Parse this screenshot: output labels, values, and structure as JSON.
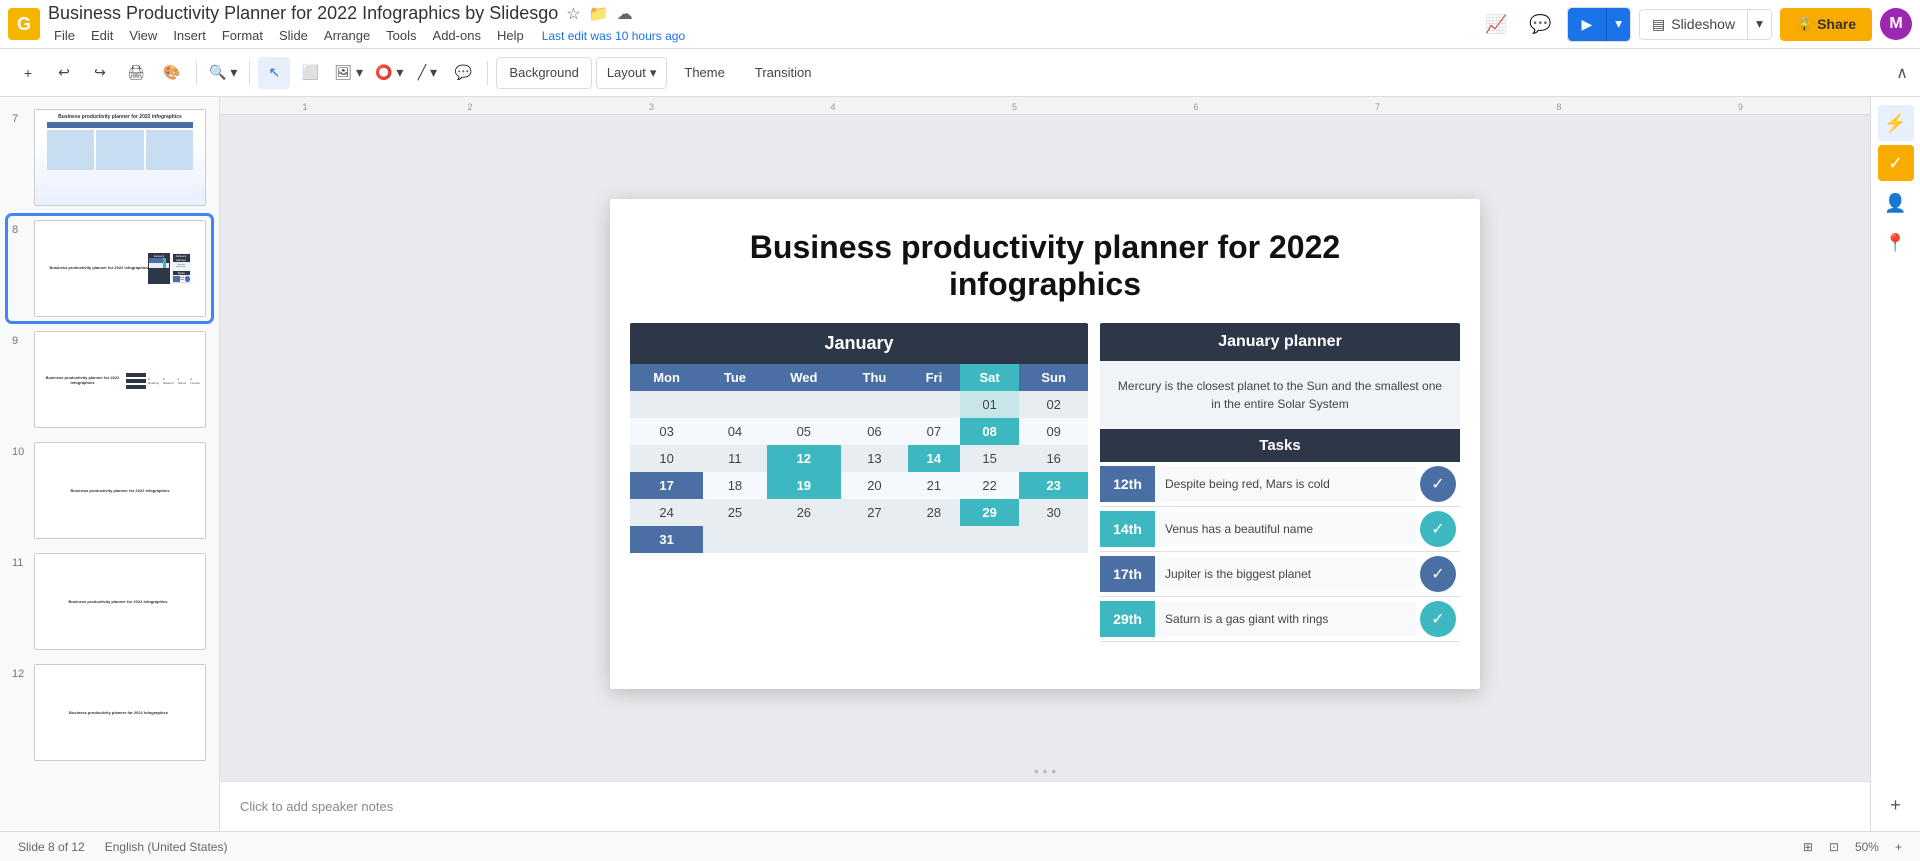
{
  "app": {
    "logo": "G",
    "title": "Business Productivity Planner for 2022 Infographics by Slidesgo",
    "last_edit": "Last edit was 10 hours ago"
  },
  "menu": {
    "items": [
      "File",
      "Edit",
      "View",
      "Insert",
      "Format",
      "Slide",
      "Arrange",
      "Tools",
      "Add-ons",
      "Help"
    ]
  },
  "toolbar": {
    "background_label": "Background",
    "layout_label": "Layout",
    "layout_arrow": "▾",
    "theme_label": "Theme",
    "transition_label": "Transition"
  },
  "top_right": {
    "slideshow_label": "Slideshow",
    "share_label": "🔒 Share"
  },
  "slide_numbers": [
    7,
    8,
    9,
    10,
    11,
    12
  ],
  "slide": {
    "title": "Business productivity planner for 2022 infographics",
    "calendar": {
      "header": "January",
      "days": [
        "Mon",
        "Tue",
        "Wed",
        "Thu",
        "Fri",
        "Sat",
        "Sun"
      ],
      "rows": [
        [
          "",
          "",
          "",
          "",
          "",
          "01",
          "02"
        ],
        [
          "03",
          "04",
          "05",
          "06",
          "07",
          "08",
          "09"
        ],
        [
          "10",
          "11",
          "12",
          "13",
          "14",
          "15",
          "16"
        ],
        [
          "17",
          "18",
          "19",
          "20",
          "21",
          "22",
          "23"
        ],
        [
          "24",
          "25",
          "26",
          "27",
          "28",
          "29",
          "30"
        ],
        [
          "31",
          "",
          "",
          "",
          "",
          "",
          ""
        ]
      ],
      "highlights": {
        "teal": [
          "08",
          "12",
          "14",
          "19",
          "23",
          "29"
        ],
        "blue": [
          "17",
          "31"
        ]
      }
    },
    "planner": {
      "header": "January planner",
      "description": "Mercury is the closest planet to the Sun and the smallest one in the entire Solar System",
      "tasks_header": "Tasks",
      "tasks": [
        {
          "date": "12th",
          "text": "Despite being red, Mars is cold",
          "style": "blue"
        },
        {
          "date": "14th",
          "text": "Venus has a beautiful name",
          "style": "teal"
        },
        {
          "date": "17th",
          "text": "Jupiter is the biggest planet",
          "style": "blue"
        },
        {
          "date": "29th",
          "text": "Saturn is a gas giant with rings",
          "style": "teal"
        }
      ]
    }
  },
  "notes": {
    "placeholder": "Click to add speaker notes"
  },
  "icons": {
    "star": "☆",
    "folder": "📁",
    "cloud": "☁",
    "trend": "📈",
    "comment": "💬",
    "present": "▶",
    "dropdown_arrow": "▾",
    "lock": "🔒",
    "check": "✓",
    "collapse": "∧",
    "zoom_in": "+",
    "cursor": "↖",
    "select_frame": "⬜",
    "image": "🖼",
    "shapes": "⬡",
    "line": "/",
    "comment2": "💬",
    "undo": "↩",
    "redo": "↪",
    "print": "🖨",
    "paint": "🎨",
    "zoom": "🔍",
    "rp1": "⚡",
    "rp2": "✓",
    "rp3": "👤",
    "rp4": "📍"
  },
  "colors": {
    "accent_blue": "#4a6fa5",
    "accent_teal": "#3db8c0",
    "dark_header": "#2d3748",
    "brand_yellow": "#f9ab00",
    "google_blue": "#1a73e8"
  }
}
